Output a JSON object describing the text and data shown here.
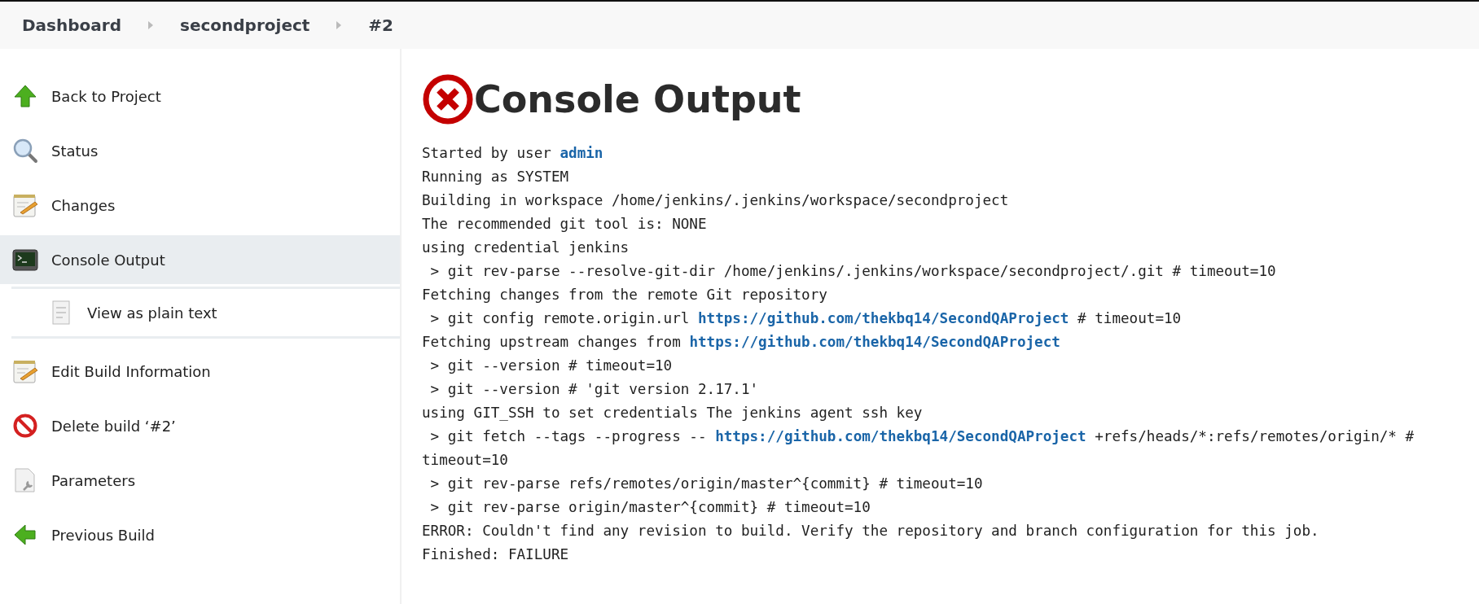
{
  "breadcrumbs": [
    "Dashboard",
    "secondproject",
    "#2"
  ],
  "sidebar": {
    "items": [
      {
        "label": "Back to Project",
        "kind": "up-arrow",
        "selected": false
      },
      {
        "label": "Status",
        "kind": "magnifier",
        "selected": false
      },
      {
        "label": "Changes",
        "kind": "notepad",
        "selected": false
      },
      {
        "label": "Console Output",
        "kind": "terminal",
        "selected": true,
        "children": [
          {
            "label": "View as plain text",
            "kind": "document",
            "selected": false
          }
        ]
      },
      {
        "label": "Edit Build Information",
        "kind": "notepad",
        "selected": false
      },
      {
        "label": "Delete build ‘#2’",
        "kind": "no-sign",
        "selected": false
      },
      {
        "label": "Parameters",
        "kind": "wrench-document",
        "selected": false
      },
      {
        "label": "Previous Build",
        "kind": "left-arrow",
        "selected": false
      }
    ]
  },
  "page": {
    "title": "Console Output",
    "failed": true
  },
  "console": [
    [
      {
        "kind": "text",
        "text": "Started by user "
      },
      {
        "kind": "link",
        "text": "admin"
      }
    ],
    [
      {
        "kind": "text",
        "text": "Running as SYSTEM"
      }
    ],
    [
      {
        "kind": "text",
        "text": "Building in workspace /home/jenkins/.jenkins/workspace/secondproject"
      }
    ],
    [
      {
        "kind": "text",
        "text": "The recommended git tool is: NONE"
      }
    ],
    [
      {
        "kind": "text",
        "text": "using credential jenkins"
      }
    ],
    [
      {
        "kind": "text",
        "text": " > git rev-parse --resolve-git-dir /home/jenkins/.jenkins/workspace/secondproject/.git # timeout=10"
      }
    ],
    [
      {
        "kind": "text",
        "text": "Fetching changes from the remote Git repository"
      }
    ],
    [
      {
        "kind": "text",
        "text": " > git config remote.origin.url "
      },
      {
        "kind": "link",
        "text": "https://github.com/thekbq14/SecondQAProject"
      },
      {
        "kind": "text",
        "text": " # timeout=10"
      }
    ],
    [
      {
        "kind": "text",
        "text": "Fetching upstream changes from "
      },
      {
        "kind": "link",
        "text": "https://github.com/thekbq14/SecondQAProject"
      }
    ],
    [
      {
        "kind": "text",
        "text": " > git --version # timeout=10"
      }
    ],
    [
      {
        "kind": "text",
        "text": " > git --version # 'git version 2.17.1'"
      }
    ],
    [
      {
        "kind": "text",
        "text": "using GIT_SSH to set credentials The jenkins agent ssh key"
      }
    ],
    [
      {
        "kind": "text",
        "text": " > git fetch --tags --progress -- "
      },
      {
        "kind": "link",
        "text": "https://github.com/thekbq14/SecondQAProject"
      },
      {
        "kind": "text",
        "text": " +refs/heads/*:refs/remotes/origin/* # timeout=10"
      }
    ],
    [
      {
        "kind": "text",
        "text": " > git rev-parse refs/remotes/origin/master^{commit} # timeout=10"
      }
    ],
    [
      {
        "kind": "text",
        "text": " > git rev-parse origin/master^{commit} # timeout=10"
      }
    ],
    [
      {
        "kind": "text",
        "text": "ERROR: Couldn't find any revision to build. Verify the repository and branch configuration for this job."
      }
    ],
    [
      {
        "kind": "text",
        "text": "Finished: FAILURE"
      }
    ]
  ]
}
